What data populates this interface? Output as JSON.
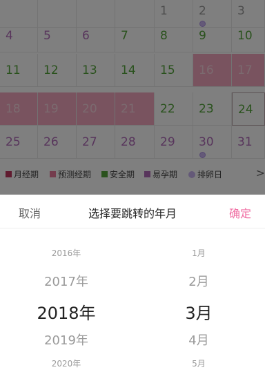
{
  "calendar": {
    "rows": [
      {
        "days": [
          {
            "label": "",
            "style": "c-gray"
          },
          {
            "label": "",
            "style": "c-gray"
          },
          {
            "label": "",
            "style": "c-gray"
          },
          {
            "label": "",
            "style": "c-gray"
          },
          {
            "label": "1",
            "style": "c-gray"
          },
          {
            "label": "2",
            "style": "c-gray",
            "ovulation": true
          },
          {
            "label": "3",
            "style": "c-gray"
          }
        ]
      },
      {
        "days": [
          {
            "label": "4",
            "style": "c-purple"
          },
          {
            "label": "5",
            "style": "c-purple"
          },
          {
            "label": "6",
            "style": "c-purple"
          },
          {
            "label": "7",
            "style": "c-green"
          },
          {
            "label": "8",
            "style": "c-green"
          },
          {
            "label": "9",
            "style": "c-green"
          },
          {
            "label": "10",
            "style": "c-green"
          }
        ]
      },
      {
        "days": [
          {
            "label": "11",
            "style": "c-green"
          },
          {
            "label": "12",
            "style": "c-green"
          },
          {
            "label": "13",
            "style": "c-green"
          },
          {
            "label": "14",
            "style": "c-green"
          },
          {
            "label": "15",
            "style": "c-green"
          },
          {
            "label": "16",
            "style": "c-pink",
            "period": true
          },
          {
            "label": "17",
            "style": "c-pink",
            "period": true
          }
        ]
      },
      {
        "days": [
          {
            "label": "18",
            "style": "c-pink",
            "period": true
          },
          {
            "label": "19",
            "style": "c-pink",
            "period": true
          },
          {
            "label": "20",
            "style": "c-pink",
            "period": true
          },
          {
            "label": "21",
            "style": "c-pink",
            "period": true
          },
          {
            "label": "22",
            "style": "c-green"
          },
          {
            "label": "23",
            "style": "c-green"
          },
          {
            "label": "24",
            "style": "c-green",
            "today": true
          }
        ]
      },
      {
        "days": [
          {
            "label": "25",
            "style": "c-purple"
          },
          {
            "label": "26",
            "style": "c-purple"
          },
          {
            "label": "27",
            "style": "c-purple"
          },
          {
            "label": "28",
            "style": "c-purple"
          },
          {
            "label": "29",
            "style": "c-purple"
          },
          {
            "label": "30",
            "style": "c-purple",
            "ovulation": true
          },
          {
            "label": "31",
            "style": "c-purple"
          }
        ]
      }
    ]
  },
  "legend": {
    "items": [
      {
        "label": "月经期",
        "color": "#c0375f"
      },
      {
        "label": "预测经期",
        "color": "#e8789a"
      },
      {
        "label": "安全期",
        "color": "#54a43b"
      },
      {
        "label": "易孕期",
        "color": "#b06bb8"
      },
      {
        "label": "排卵日",
        "color": "#c9b3f0",
        "round": true
      }
    ],
    "more_arrow": ">"
  },
  "picker": {
    "cancel": "取消",
    "title": "选择要跳转的年月",
    "confirm": "确定",
    "years": [
      "2016年",
      "2017年",
      "2018年",
      "2019年",
      "2020年"
    ],
    "months": [
      "1月",
      "2月",
      "3月",
      "4月",
      "5月"
    ],
    "selected_year": "2018年",
    "selected_month": "3月",
    "accent_color": "#f06ea3"
  }
}
